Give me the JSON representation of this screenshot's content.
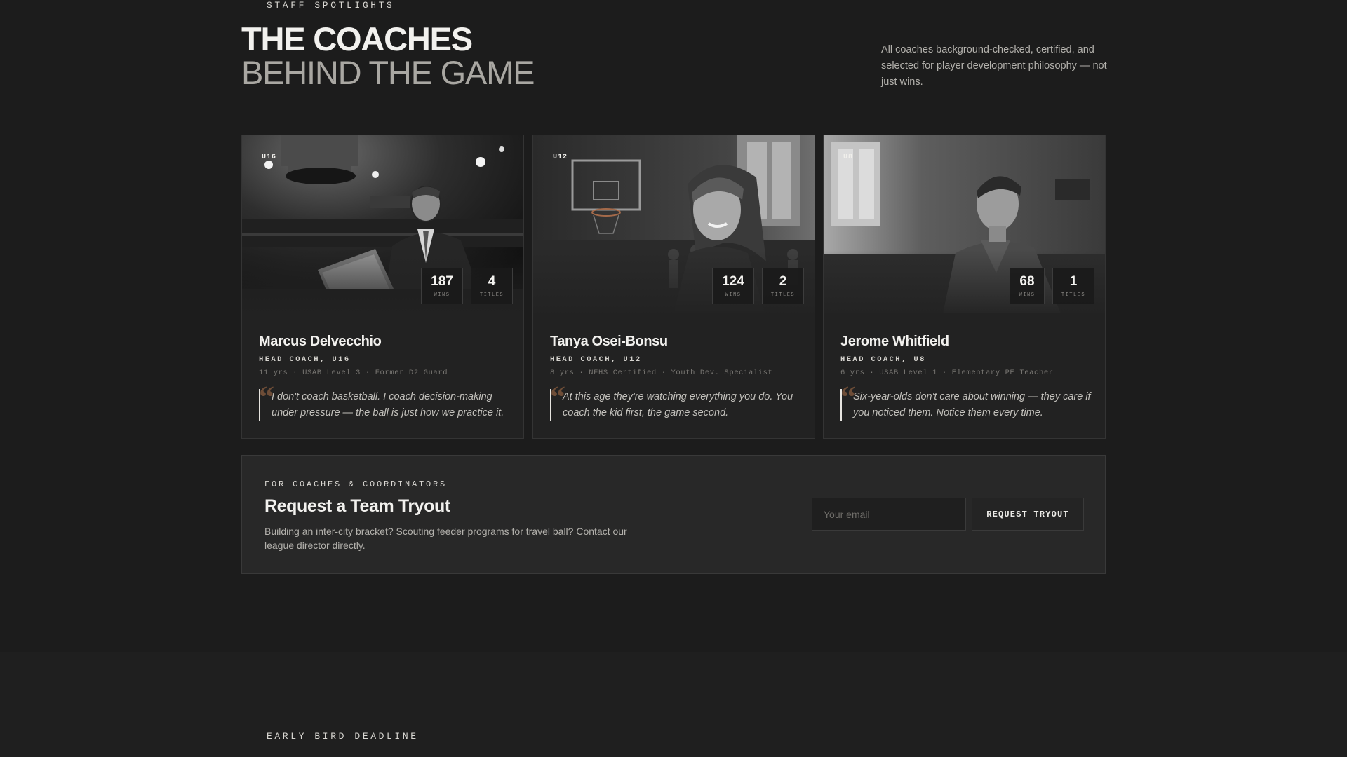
{
  "header": {
    "eyebrow": "STAFF SPOTLIGHTS",
    "title_line1": "THE COACHES",
    "title_line2": "BEHIND THE GAME",
    "intro": "All coaches background-checked, certified, and selected for player development philosophy — not just wins."
  },
  "coaches": [
    {
      "age_group": "U16",
      "name": "Marcus Delvecchio",
      "role": "HEAD COACH, U16",
      "meta": "11 yrs · USAB Level 3 · Former D2 Guard",
      "quote": "I don't coach basketball. I coach decision-making under pressure — the ball is just how we practice it.",
      "stats": [
        {
          "value": "187",
          "label": "WINS"
        },
        {
          "value": "4",
          "label": "TITLES"
        }
      ]
    },
    {
      "age_group": "U12",
      "name": "Tanya Osei-Bonsu",
      "role": "HEAD COACH, U12",
      "meta": "8 yrs · NFHS Certified · Youth Dev. Specialist",
      "quote": "At this age they're watching everything you do. You coach the kid first, the game second.",
      "stats": [
        {
          "value": "124",
          "label": "WINS"
        },
        {
          "value": "2",
          "label": "TITLES"
        }
      ]
    },
    {
      "age_group": "U8",
      "name": "Jerome Whitfield",
      "role": "HEAD COACH, U8",
      "meta": "6 yrs · USAB Level 1 · Elementary PE Teacher",
      "quote": "Six-year-olds don't care about winning — they care if you noticed them. Notice them every time.",
      "stats": [
        {
          "value": "68",
          "label": "WINS"
        },
        {
          "value": "1",
          "label": "TITLES"
        }
      ]
    }
  ],
  "tryout": {
    "eyebrow": "FOR COACHES & COORDINATORS",
    "heading": "Request a Team Tryout",
    "description": "Building an inter-city bracket? Scouting feeder programs for travel ball? Contact our league director directly.",
    "email_placeholder": "Your email",
    "button_label": "REQUEST TRYOUT"
  },
  "next_section": {
    "eyebrow": "EARLY BIRD DEADLINE"
  },
  "quote_glyph": "“",
  "colors": {
    "background": "#1c1c1c",
    "card": "#222222",
    "accent_quote": "#6e4d37"
  }
}
